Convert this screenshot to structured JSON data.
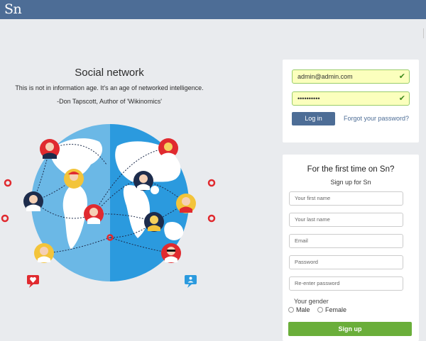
{
  "header": {
    "logo": "Sn"
  },
  "hero": {
    "title": "Social network",
    "quote": "This is not in information age. It's an age of networked intelligence.",
    "author": "-Don Tapscott, Author of 'Wikinomics'"
  },
  "login": {
    "email_value": "admin@admin.com",
    "password_value": "••••••••••",
    "login_label": "Log in",
    "forgot_label": "Forgot your password?"
  },
  "signup": {
    "title": "For the first time on Sn?",
    "subtitle": "Sign up for Sn",
    "first_name_placeholder": "Your first name",
    "last_name_placeholder": "Your last name",
    "email_placeholder": "Email",
    "password_placeholder": "Password",
    "reenter_placeholder": "Re-enter password",
    "gender_label": "Your gender",
    "male_label": "Male",
    "female_label": "Female",
    "signup_label": "Sign up"
  },
  "colors": {
    "header": "#4d6d96",
    "background": "#e9ebee",
    "signup_button": "#6aae3a",
    "valid_field": "#fbffbd"
  },
  "illustration": {
    "icons": [
      "globe-icon",
      "avatar-icon",
      "heart-chat-icon",
      "user-chat-icon",
      "ring-icon"
    ]
  }
}
